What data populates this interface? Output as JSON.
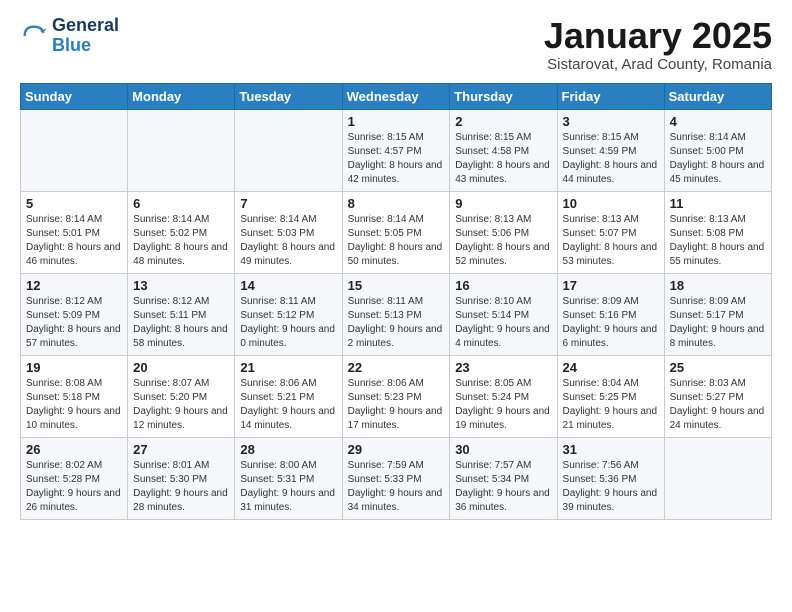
{
  "header": {
    "logo_general": "General",
    "logo_blue": "Blue",
    "month_title": "January 2025",
    "location": "Sistarovat, Arad County, Romania"
  },
  "weekdays": [
    "Sunday",
    "Monday",
    "Tuesday",
    "Wednesday",
    "Thursday",
    "Friday",
    "Saturday"
  ],
  "weeks": [
    [
      {
        "day": "",
        "info": ""
      },
      {
        "day": "",
        "info": ""
      },
      {
        "day": "",
        "info": ""
      },
      {
        "day": "1",
        "info": "Sunrise: 8:15 AM\nSunset: 4:57 PM\nDaylight: 8 hours and 42 minutes."
      },
      {
        "day": "2",
        "info": "Sunrise: 8:15 AM\nSunset: 4:58 PM\nDaylight: 8 hours and 43 minutes."
      },
      {
        "day": "3",
        "info": "Sunrise: 8:15 AM\nSunset: 4:59 PM\nDaylight: 8 hours and 44 minutes."
      },
      {
        "day": "4",
        "info": "Sunrise: 8:14 AM\nSunset: 5:00 PM\nDaylight: 8 hours and 45 minutes."
      }
    ],
    [
      {
        "day": "5",
        "info": "Sunrise: 8:14 AM\nSunset: 5:01 PM\nDaylight: 8 hours and 46 minutes."
      },
      {
        "day": "6",
        "info": "Sunrise: 8:14 AM\nSunset: 5:02 PM\nDaylight: 8 hours and 48 minutes."
      },
      {
        "day": "7",
        "info": "Sunrise: 8:14 AM\nSunset: 5:03 PM\nDaylight: 8 hours and 49 minutes."
      },
      {
        "day": "8",
        "info": "Sunrise: 8:14 AM\nSunset: 5:05 PM\nDaylight: 8 hours and 50 minutes."
      },
      {
        "day": "9",
        "info": "Sunrise: 8:13 AM\nSunset: 5:06 PM\nDaylight: 8 hours and 52 minutes."
      },
      {
        "day": "10",
        "info": "Sunrise: 8:13 AM\nSunset: 5:07 PM\nDaylight: 8 hours and 53 minutes."
      },
      {
        "day": "11",
        "info": "Sunrise: 8:13 AM\nSunset: 5:08 PM\nDaylight: 8 hours and 55 minutes."
      }
    ],
    [
      {
        "day": "12",
        "info": "Sunrise: 8:12 AM\nSunset: 5:09 PM\nDaylight: 8 hours and 57 minutes."
      },
      {
        "day": "13",
        "info": "Sunrise: 8:12 AM\nSunset: 5:11 PM\nDaylight: 8 hours and 58 minutes."
      },
      {
        "day": "14",
        "info": "Sunrise: 8:11 AM\nSunset: 5:12 PM\nDaylight: 9 hours and 0 minutes."
      },
      {
        "day": "15",
        "info": "Sunrise: 8:11 AM\nSunset: 5:13 PM\nDaylight: 9 hours and 2 minutes."
      },
      {
        "day": "16",
        "info": "Sunrise: 8:10 AM\nSunset: 5:14 PM\nDaylight: 9 hours and 4 minutes."
      },
      {
        "day": "17",
        "info": "Sunrise: 8:09 AM\nSunset: 5:16 PM\nDaylight: 9 hours and 6 minutes."
      },
      {
        "day": "18",
        "info": "Sunrise: 8:09 AM\nSunset: 5:17 PM\nDaylight: 9 hours and 8 minutes."
      }
    ],
    [
      {
        "day": "19",
        "info": "Sunrise: 8:08 AM\nSunset: 5:18 PM\nDaylight: 9 hours and 10 minutes."
      },
      {
        "day": "20",
        "info": "Sunrise: 8:07 AM\nSunset: 5:20 PM\nDaylight: 9 hours and 12 minutes."
      },
      {
        "day": "21",
        "info": "Sunrise: 8:06 AM\nSunset: 5:21 PM\nDaylight: 9 hours and 14 minutes."
      },
      {
        "day": "22",
        "info": "Sunrise: 8:06 AM\nSunset: 5:23 PM\nDaylight: 9 hours and 17 minutes."
      },
      {
        "day": "23",
        "info": "Sunrise: 8:05 AM\nSunset: 5:24 PM\nDaylight: 9 hours and 19 minutes."
      },
      {
        "day": "24",
        "info": "Sunrise: 8:04 AM\nSunset: 5:25 PM\nDaylight: 9 hours and 21 minutes."
      },
      {
        "day": "25",
        "info": "Sunrise: 8:03 AM\nSunset: 5:27 PM\nDaylight: 9 hours and 24 minutes."
      }
    ],
    [
      {
        "day": "26",
        "info": "Sunrise: 8:02 AM\nSunset: 5:28 PM\nDaylight: 9 hours and 26 minutes."
      },
      {
        "day": "27",
        "info": "Sunrise: 8:01 AM\nSunset: 5:30 PM\nDaylight: 9 hours and 28 minutes."
      },
      {
        "day": "28",
        "info": "Sunrise: 8:00 AM\nSunset: 5:31 PM\nDaylight: 9 hours and 31 minutes."
      },
      {
        "day": "29",
        "info": "Sunrise: 7:59 AM\nSunset: 5:33 PM\nDaylight: 9 hours and 34 minutes."
      },
      {
        "day": "30",
        "info": "Sunrise: 7:57 AM\nSunset: 5:34 PM\nDaylight: 9 hours and 36 minutes."
      },
      {
        "day": "31",
        "info": "Sunrise: 7:56 AM\nSunset: 5:36 PM\nDaylight: 9 hours and 39 minutes."
      },
      {
        "day": "",
        "info": ""
      }
    ]
  ]
}
